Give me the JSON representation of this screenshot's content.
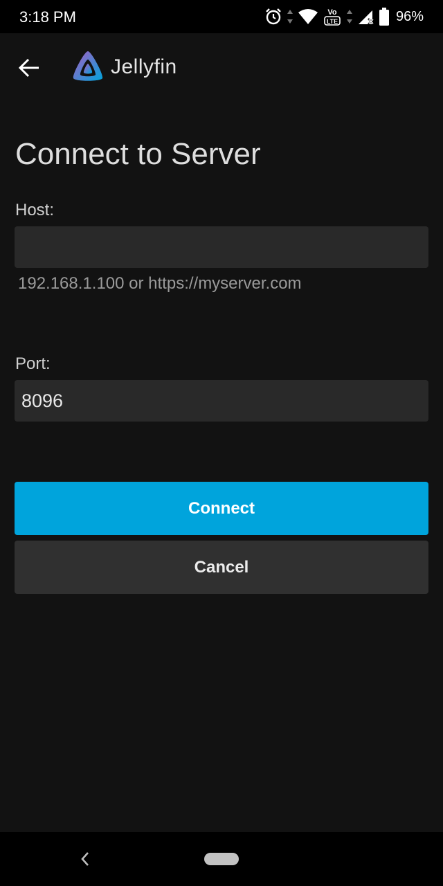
{
  "status_bar": {
    "time": "3:18 PM",
    "battery": "96%",
    "icons": [
      "alarm-icon",
      "wifi-icon",
      "volte-icon",
      "signal-icon",
      "battery-icon"
    ],
    "volte_label": "VoLTE"
  },
  "app_bar": {
    "title": "Jellyfin",
    "back_icon": "arrow-left-icon",
    "logo_icon": "jellyfin-logo-icon"
  },
  "main": {
    "title": "Connect to Server",
    "host": {
      "label": "Host:",
      "value": "",
      "hint": "192.168.1.100 or https://myserver.com"
    },
    "port": {
      "label": "Port:",
      "value": "8096"
    },
    "connect_label": "Connect",
    "cancel_label": "Cancel"
  },
  "colors": {
    "background": "#121212",
    "input_background": "#292929",
    "accent": "#00a4dc",
    "secondary_button": "#303030"
  },
  "nav_bar": {
    "icons": [
      "nav-back-icon",
      "nav-home-pill"
    ]
  }
}
